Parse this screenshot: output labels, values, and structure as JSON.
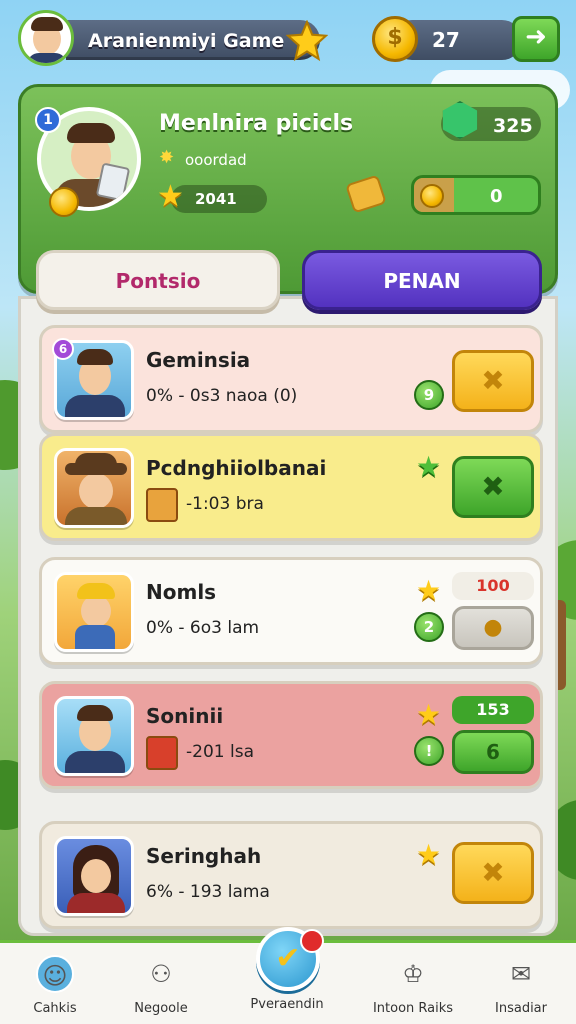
{
  "colors": {
    "accent_green": "#4e9a35",
    "accent_purple": "#5332c0",
    "coin_gold": "#f5b800",
    "tab_text_magenta": "#b2296b"
  },
  "header": {
    "title": "Aranienmiyi Game",
    "coins": "27",
    "icons": [
      "avatar",
      "star-icon",
      "coin-icon",
      "arrow-right-icon"
    ]
  },
  "profile": {
    "level": "1",
    "name": "Menlnira picicls",
    "subtitle": "ooordad",
    "score": "2041",
    "gems": "325",
    "progress_value": "0"
  },
  "tabs": [
    {
      "label": "Pontsio",
      "active": false
    },
    {
      "label": "PENAN",
      "active": true
    }
  ],
  "cards": [
    {
      "title": "Geminsia",
      "stat": "0% - 0s3 naoa (0)",
      "indicator": "9",
      "badge": "6"
    },
    {
      "title": "Pcdnghiiolbanai",
      "stat": "-1:03 bra"
    },
    {
      "title": "Nomls",
      "stat": "0% - 6o3 lam",
      "value": "100",
      "indicator": "2"
    },
    {
      "title": "Soninii",
      "stat": "-201 lsa",
      "value": "153",
      "indicator": "!",
      "button_value": "6"
    },
    {
      "title": "Seringhah",
      "stat": "6% - 193 lama"
    }
  ],
  "bottom_nav": [
    {
      "label": "Cahkis",
      "icon": "avatar-icon"
    },
    {
      "label": "Negoole",
      "icon": "people-icon"
    },
    {
      "label": "Pveraendin",
      "icon": "check-icon"
    },
    {
      "label": "Intoon Raiks",
      "icon": "chef-hat-icon"
    },
    {
      "label": "Insadiar",
      "icon": "chat-icon"
    }
  ]
}
